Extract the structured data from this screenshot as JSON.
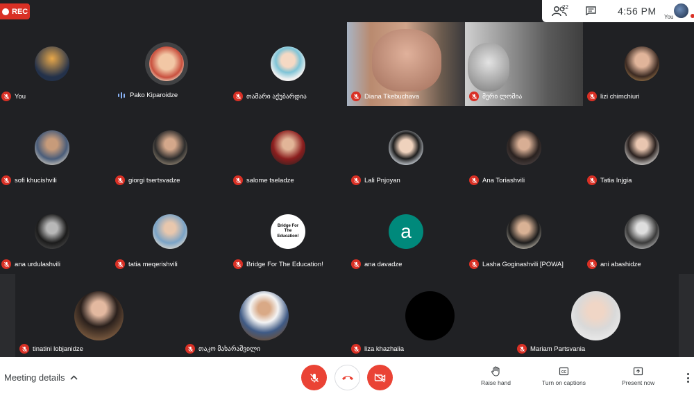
{
  "top": {
    "rec_label": "REC",
    "participant_count": "22",
    "time": "4:56 PM",
    "self_label": "You"
  },
  "participants": [
    {
      "name": "You",
      "muted": true
    },
    {
      "name": "Pako Kiparoidze",
      "muted": false,
      "speaking": true
    },
    {
      "name": "თამარი აქუბარდია",
      "muted": true
    },
    {
      "name": "Diana Tkebuchava",
      "muted": true,
      "video": true
    },
    {
      "name": "მერი ლომია",
      "muted": true,
      "video": true
    },
    {
      "name": "lizi chimchiuri",
      "muted": true
    },
    {
      "name": "sofi khucishvili",
      "muted": true
    },
    {
      "name": "giorgi tsertsvadze",
      "muted": true
    },
    {
      "name": "salome tseladze",
      "muted": true
    },
    {
      "name": "Lali Pnjoyan",
      "muted": true
    },
    {
      "name": "Ana Toriashvili",
      "muted": true
    },
    {
      "name": "Tatia Injgia",
      "muted": true
    },
    {
      "name": "ana urdulashvili",
      "muted": true
    },
    {
      "name": "tatia meqerishvili",
      "muted": true
    },
    {
      "name": "Bridge For The Education!",
      "muted": true,
      "logo_text": "Bridge For The Education!"
    },
    {
      "name": "ana davadze",
      "muted": true,
      "initial": "a"
    },
    {
      "name": "Lasha Goginashvili [POWA]",
      "muted": true
    },
    {
      "name": "ani abashidze",
      "muted": true
    },
    {
      "name": "tinatini lobjanidze",
      "muted": true
    },
    {
      "name": "თაკო მახარაშვილი",
      "muted": true
    },
    {
      "name": "liza khazhalia",
      "muted": true
    },
    {
      "name": "Mariam Partsvania",
      "muted": true
    }
  ],
  "bottom": {
    "meeting_details": "Meeting details",
    "raise_hand": "Raise hand",
    "captions": "Turn on captions",
    "present": "Present now"
  },
  "colors": {
    "background": "#202124",
    "tile": "#3c4043",
    "red": "#ea4335",
    "speaking": "#8ab4f8",
    "teal_avatar": "#00897b"
  }
}
